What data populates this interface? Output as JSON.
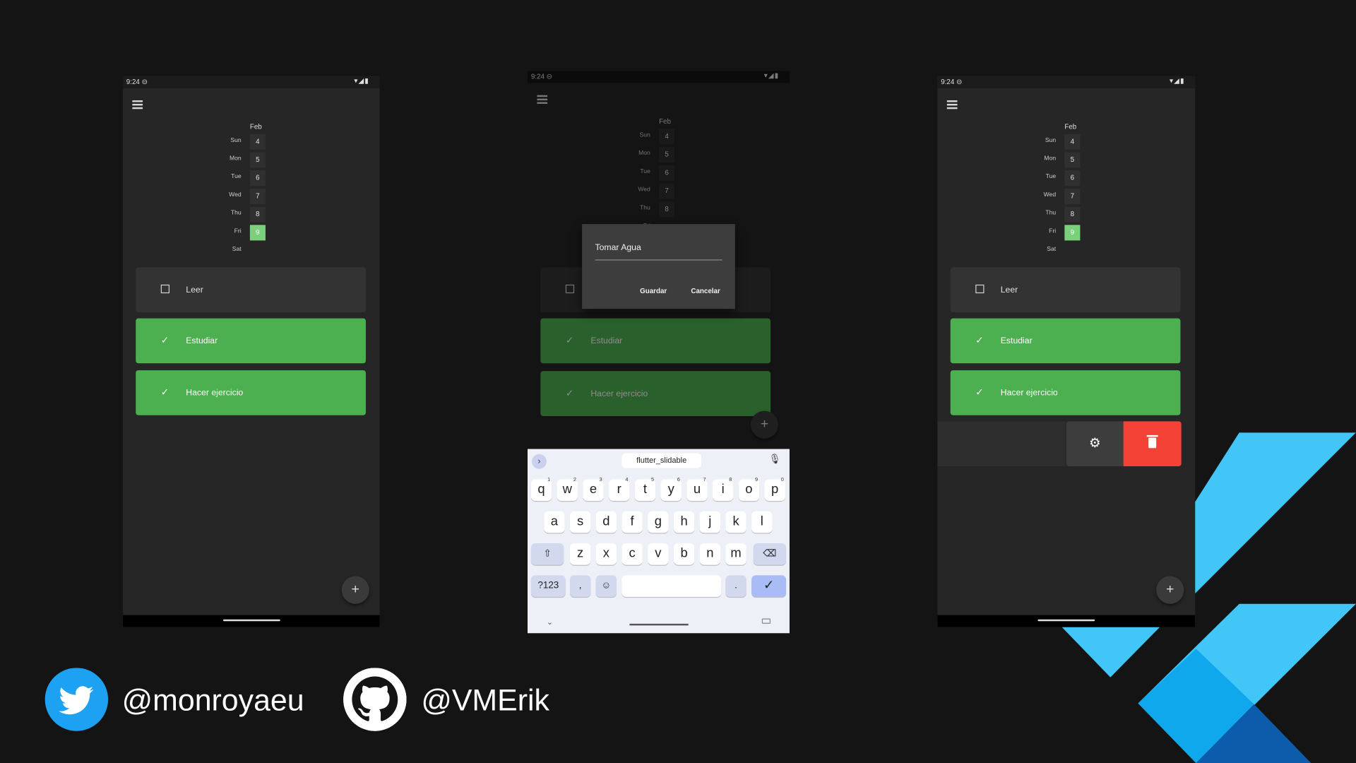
{
  "status_time": "9:24",
  "calendar": {
    "month": "Feb",
    "days": [
      {
        "day": "Sun",
        "num": "4"
      },
      {
        "day": "Mon",
        "num": "5"
      },
      {
        "day": "Tue",
        "num": "6"
      },
      {
        "day": "Wed",
        "num": "7"
      },
      {
        "day": "Thu",
        "num": "8"
      },
      {
        "day": "Fri",
        "num": "9"
      },
      {
        "day": "Sat",
        "num": ""
      }
    ]
  },
  "tasks": [
    {
      "label": "Leer",
      "done": false
    },
    {
      "label": "Estudiar",
      "done": true
    },
    {
      "label": "Hacer ejercicio",
      "done": true
    }
  ],
  "dialog": {
    "input_value": "Tomar Agua",
    "save_label": "Guardar",
    "cancel_label": "Cancelar"
  },
  "keyboard": {
    "suggestion": "flutter_slidable",
    "row1": [
      "q",
      "w",
      "e",
      "r",
      "t",
      "y",
      "u",
      "i",
      "o",
      "p"
    ],
    "row1_digits": [
      "1",
      "2",
      "3",
      "4",
      "5",
      "6",
      "7",
      "8",
      "9",
      "0"
    ],
    "row2": [
      "a",
      "s",
      "d",
      "f",
      "g",
      "h",
      "j",
      "k",
      "l"
    ],
    "row3": [
      "z",
      "x",
      "c",
      "v",
      "b",
      "n",
      "m"
    ],
    "symbols_label": "?123",
    "comma": ",",
    "period": "."
  },
  "fab_label": "+",
  "social": {
    "twitter": "@monroyaeu",
    "github": "@VMErik"
  },
  "colors": {
    "background": "#141414",
    "done_green": "#4caf50",
    "delete_red": "#f44336",
    "flutter_blue": "#42c5f7"
  }
}
